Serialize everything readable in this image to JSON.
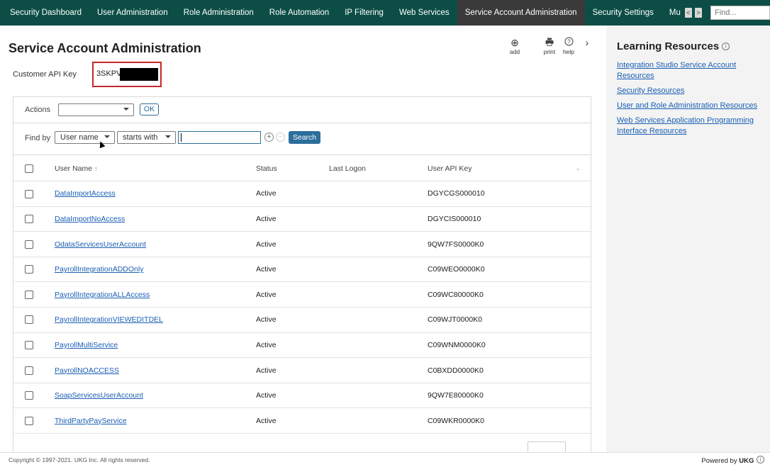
{
  "nav": {
    "tabs": [
      {
        "label": "Security Dashboard"
      },
      {
        "label": "User Administration"
      },
      {
        "label": "Role Administration"
      },
      {
        "label": "Role Automation"
      },
      {
        "label": "IP Filtering"
      },
      {
        "label": "Web Services"
      },
      {
        "label": "Service Account Administration",
        "active": true
      },
      {
        "label": "Security Settings"
      },
      {
        "label": "Mu"
      }
    ],
    "prev_label": "<",
    "next_label": ">",
    "find_placeholder": "Find..."
  },
  "page": {
    "title": "Service Account Administration",
    "tools": {
      "add": "add",
      "print": "print",
      "help": "help"
    },
    "api_key_label": "Customer API Key",
    "api_key_value": "3SKPV"
  },
  "actions": {
    "label": "Actions",
    "ok_label": "OK"
  },
  "find": {
    "label": "Find by",
    "field": "User name",
    "operator": "starts with",
    "value": "",
    "search_label": "Search"
  },
  "table": {
    "headers": {
      "name": "User Name",
      "status": "Status",
      "last_logon": "Last Logon",
      "api_key": "User API Key"
    },
    "rows": [
      {
        "name": "DataImportAccess",
        "status": "Active",
        "last_logon": "",
        "api_key": "DGYCGS000010"
      },
      {
        "name": "DataImportNoAccess",
        "status": "Active",
        "last_logon": "",
        "api_key": "DGYCIS000010"
      },
      {
        "name": "OdataServicesUserAccount",
        "status": "Active",
        "last_logon": "",
        "api_key": "9QW7FS0000K0"
      },
      {
        "name": "PayrollIntegrationADDOnly",
        "status": "Active",
        "last_logon": "",
        "api_key": "C09WEO0000K0"
      },
      {
        "name": "PayrollIntegrationALLAccess",
        "status": "Active",
        "last_logon": "",
        "api_key": "C09WC80000K0"
      },
      {
        "name": "PayrollIntegrationVIEWEDITDEL",
        "status": "Active",
        "last_logon": "",
        "api_key": "C09WJT0000K0"
      },
      {
        "name": "PayrollMultiService",
        "status": "Active",
        "last_logon": "",
        "api_key": "C09WNM0000K0"
      },
      {
        "name": "PayrollNOACCESS",
        "status": "Active",
        "last_logon": "",
        "api_key": "C0BXDD0000K0"
      },
      {
        "name": "SoapServicesUserAccount",
        "status": "Active",
        "last_logon": "",
        "api_key": "9QW7E80000K0"
      },
      {
        "name": "ThirdPartyPayService",
        "status": "Active",
        "last_logon": "",
        "api_key": "C09WKR0000K0"
      }
    ]
  },
  "learning": {
    "title": "Learning Resources",
    "links": [
      "Integration Studio Service Account Resources",
      "Security Resources",
      "User and Role Administration Resources",
      "Web Services Application Programming Interface Resources"
    ]
  },
  "footer": {
    "copyright": "Copyright © 1997-2021. UKG Inc. All rights reserved.",
    "powered_prefix": "Powered by",
    "powered_brand": "UKG"
  }
}
